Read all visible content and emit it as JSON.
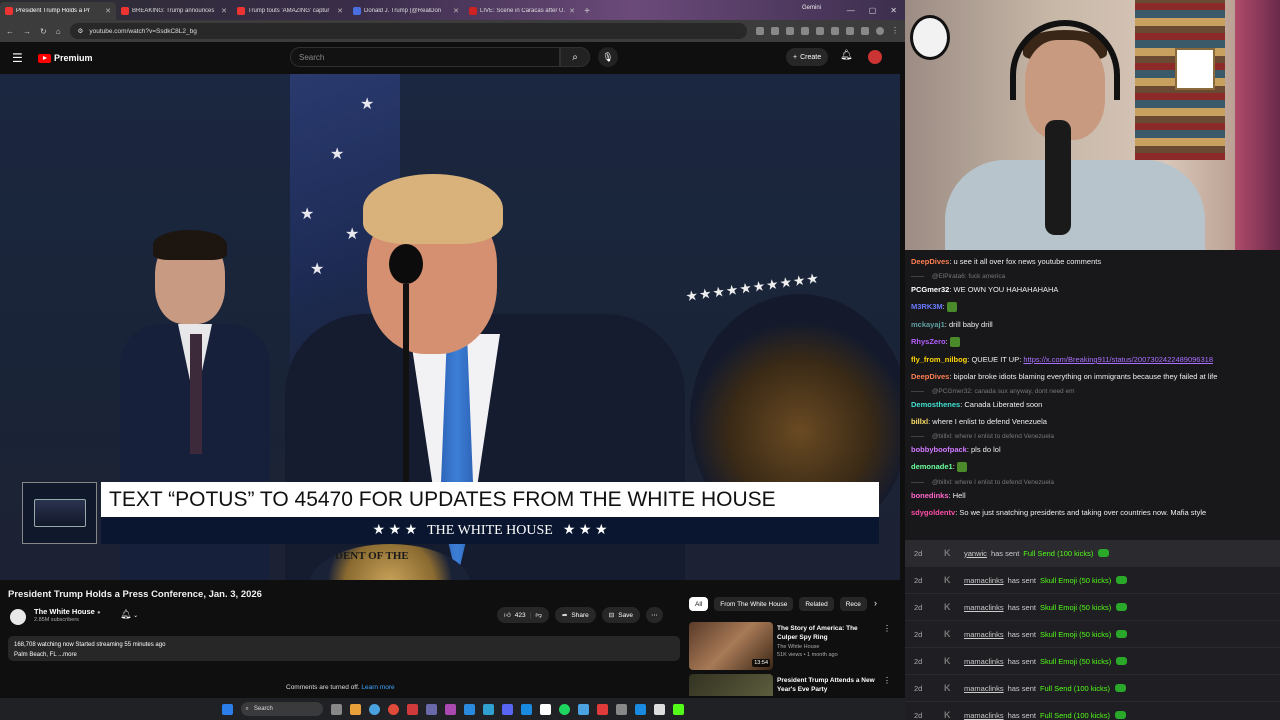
{
  "browser": {
    "tabs": [
      {
        "label": "President Trump Holds a Pr",
        "active": true
      },
      {
        "label": "BREAKING: Trump announces",
        "active": false
      },
      {
        "label": "Trump touts 'AMAZING' captur",
        "active": false
      },
      {
        "label": "Donald J. Trump (@RealDon",
        "active": false
      },
      {
        "label": "LIVE: Scene in Caracas after U.",
        "active": false
      }
    ],
    "gemini_label": "Gemini",
    "url": "youtube.com/watch?v=SsdkC8L2_bg"
  },
  "youtube": {
    "logo_label": "Premium",
    "search_placeholder": "Search",
    "create_label": "Create",
    "video": {
      "banner_text": "TEXT “POTUS” TO 45470 FOR UPDATES FROM THE WHITE HOUSE",
      "banner_sub": "THE WHITE HOUSE",
      "banner_stars": "★ ★ ★",
      "seal_text": "DENT OF THE"
    },
    "title": "President Trump Holds a Press Conference, Jan. 3, 2026",
    "channel": {
      "name": "The White House",
      "subs": "2.85M subscribers"
    },
    "actions": {
      "likes": "423",
      "share": "Share",
      "save": "Save"
    },
    "description": {
      "line1": "168,708 watching now  Started streaming 55 minutes ago",
      "line2": "Palm Beach, FL ...more"
    },
    "comments_off": "Comments are turned off.",
    "learn_more": "Learn more",
    "chips": [
      "All",
      "From The White House",
      "Related",
      "Rece"
    ],
    "recommendations": [
      {
        "title": "The Story of America: The Culper Spy Ring",
        "channel": "The White House",
        "meta": "51K views • 1 month ago",
        "duration": "13:54"
      },
      {
        "title": "President Trump Attends a New Year's Eve Party",
        "channel": "",
        "meta": "",
        "duration": ""
      }
    ]
  },
  "taskbar": {
    "search_label": "Search"
  },
  "chat": {
    "messages": [
      {
        "user": "DeepDives",
        "color": "#ff7f50",
        "text": "u see it all over fox news youtube comments"
      },
      {
        "reply": "@ElPirata6: fuck america"
      },
      {
        "user": "PCGmer32",
        "color": "#ffffff",
        "text": "WE OWN YOU HAHAHAHAHA"
      },
      {
        "user": "M3RK3M",
        "color": "#6a7aff",
        "text": ""
      },
      {
        "user": "mckayaj1",
        "color": "#5f9ea0",
        "text": "drill baby drill"
      },
      {
        "user": "RhysZero",
        "color": "#b45fff",
        "text": ""
      },
      {
        "user": "fly_from_nilbog",
        "color": "#ffd700",
        "text": "QUEUE IT UP:",
        "link": "https://x.com/Breaking911/status/2007302422489096318"
      },
      {
        "user": "DeepDives",
        "color": "#ff7f50",
        "text": "bipolar broke idiots blaming everything on immigrants because they failed at life"
      },
      {
        "reply": "@PCGmer32: canada sux anyway, dont need em"
      },
      {
        "user": "Demosthenes",
        "color": "#40e0d0",
        "text": "Canada Liberated soon"
      },
      {
        "user": "billxl",
        "color": "#ffe066",
        "text": "where I enlist to defend Venezuela"
      },
      {
        "reply": "@billxl: where I enlist to defend Venezuela"
      },
      {
        "user": "bobbyboofpack",
        "color": "#d07aff",
        "text": "pls do lol"
      },
      {
        "user": "demonade1",
        "color": "#6aff9a",
        "text": ""
      },
      {
        "reply": "@billxl: where I enlist to defend Venezuela"
      },
      {
        "user": "bonedinks",
        "color": "#ff66cc",
        "text": "Hell"
      },
      {
        "user": "sdygoldentv",
        "color": "#ff4da6",
        "text": "So we just snatching presidents and taking over countries now. Mafia style"
      }
    ]
  },
  "alerts": [
    {
      "time": "2d",
      "user": "yanwic",
      "text": "has sent",
      "gift": "Full Send (100 kicks)"
    },
    {
      "time": "2d",
      "user": "mamaclinks",
      "text": "has sent",
      "gift": "Skull Emoji (50 kicks)"
    },
    {
      "time": "2d",
      "user": "mamaclinks",
      "text": "has sent",
      "gift": "Skull Emoji (50 kicks)"
    },
    {
      "time": "2d",
      "user": "mamaclinks",
      "text": "has sent",
      "gift": "Skull Emoji (50 kicks)"
    },
    {
      "time": "2d",
      "user": "mamaclinks",
      "text": "has sent",
      "gift": "Skull Emoji (50 kicks)"
    },
    {
      "time": "2d",
      "user": "mamaclinks",
      "text": "has sent",
      "gift": "Full Send (100 kicks)"
    },
    {
      "time": "2d",
      "user": "mamaclinks",
      "text": "has sent",
      "gift": "Full Send (100 kicks)"
    }
  ]
}
